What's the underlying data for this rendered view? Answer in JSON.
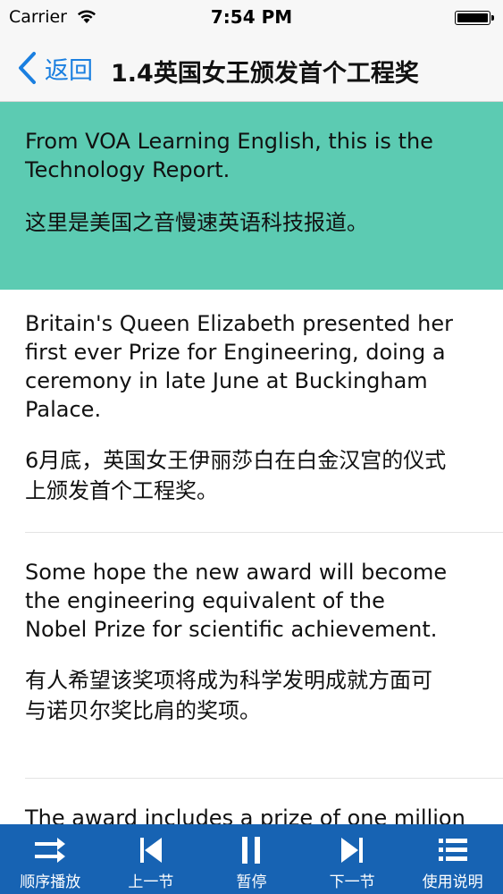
{
  "status_bar": {
    "carrier": "Carrier",
    "time": "7:54 PM"
  },
  "nav": {
    "back_label": "返回",
    "title": "1.4英国女王颁发首个工程奖"
  },
  "paragraphs": [
    {
      "en": "From VOA Learning English, this is the Technology Report.",
      "zh": "这里是美国之音慢速英语科技报道。",
      "highlighted": true
    },
    {
      "en": "Britain's Queen Elizabeth presented her first ever Prize for Engineering, doing a ceremony in late June at Buckingham Palace.",
      "zh": "6月底，英国女王伊丽莎白在白金汉宫的仪式上颁发首个工程奖。",
      "highlighted": false
    },
    {
      "en": "Some hope the new award will become the engineering equivalent of the Nobel Prize for scientific achievement.",
      "zh": "有人希望该奖项将成为科学发明成就方面可与诺贝尔奖比肩的奖项。",
      "highlighted": false
    },
    {
      "en": "The award includes a prize of one million",
      "zh": "",
      "highlighted": false
    }
  ],
  "toolbar": {
    "sequential_label": "顺序播放",
    "prev_label": "上一节",
    "pause_label": "暂停",
    "next_label": "下一节",
    "help_label": "使用说明"
  },
  "colors": {
    "highlight": "#5ccbb2",
    "toolbar": "#1763b3",
    "accent": "#1a7fe0"
  }
}
